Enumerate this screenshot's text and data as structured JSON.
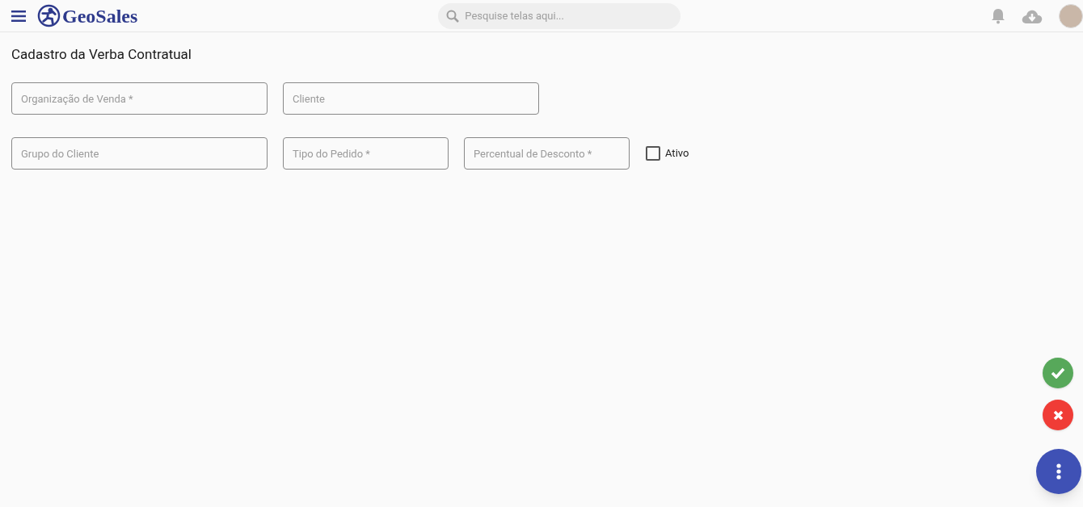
{
  "header": {
    "logo_text": "GeoSales",
    "search": {
      "placeholder": "Pesquise telas aqui..."
    }
  },
  "page": {
    "title": "Cadastro da Verba Contratual"
  },
  "form_rows": [
    {
      "fields": [
        {
          "kind": "text",
          "placeholder": "Organização de Venda *"
        },
        {
          "kind": "text",
          "placeholder": "Cliente"
        }
      ]
    },
    {
      "fields": [
        {
          "kind": "text",
          "placeholder": "Grupo do Cliente"
        },
        {
          "kind": "text",
          "placeholder": "Tipo do Pedido *"
        },
        {
          "kind": "text",
          "placeholder": "Percentual de Desconto *"
        },
        {
          "kind": "checkbox",
          "label": "Ativo",
          "checked": false
        }
      ]
    }
  ]
}
